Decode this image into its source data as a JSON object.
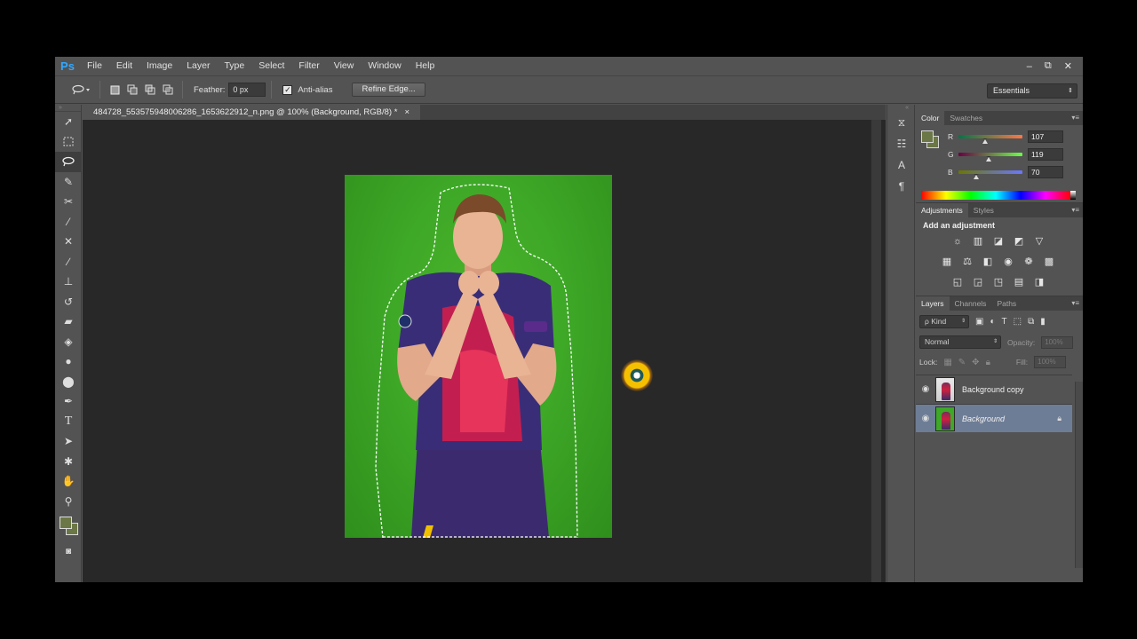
{
  "app": {
    "logo": "Ps"
  },
  "menu": [
    "File",
    "Edit",
    "Image",
    "Layer",
    "Type",
    "Select",
    "Filter",
    "View",
    "Window",
    "Help"
  ],
  "window_controls": {
    "minimize": "–",
    "restore": "⧉",
    "close": "✕"
  },
  "options_bar": {
    "feather_label": "Feather:",
    "feather_value": "0 px",
    "antialias_label": "Anti-alias",
    "antialias_checked": "✓",
    "refine_edge": "Refine Edge...",
    "workspace": "Essentials"
  },
  "document": {
    "tab_title": "484728_553575948006286_1653622912_n.png @ 100% (Background, RGB/8) *",
    "close": "×"
  },
  "colors": {
    "foreground": "#6b7746",
    "background": "#6b7746",
    "canvas_bg": "#282828",
    "selection_blue": "#6e7d96"
  },
  "color_panel": {
    "tabs": [
      "Color",
      "Swatches"
    ],
    "r_label": "R",
    "r_value": "107",
    "g_label": "G",
    "g_value": "119",
    "b_label": "B",
    "b_value": "70"
  },
  "adjustments_panel": {
    "tabs": [
      "Adjustments",
      "Styles"
    ],
    "title": "Add an adjustment"
  },
  "layers_panel": {
    "tabs": [
      "Layers",
      "Channels",
      "Paths"
    ],
    "kind_filter": "ρ Kind",
    "blend_mode": "Normal",
    "opacity_label": "Opacity:",
    "opacity_value": "100%",
    "lock_label": "Lock:",
    "fill_label": "Fill:",
    "fill_value": "100%",
    "layers": [
      {
        "name": "Background copy",
        "selected": false
      },
      {
        "name": "Background",
        "selected": true
      }
    ]
  },
  "icons": {
    "tools": [
      "move-icon",
      "marquee-icon",
      "lasso-icon",
      "quick-selection-icon",
      "crop-icon",
      "eyedropper-icon",
      "healing-brush-icon",
      "brush-icon",
      "clone-stamp-icon",
      "history-brush-icon",
      "eraser-icon",
      "paint-bucket-icon",
      "blur-icon",
      "dodge-icon",
      "pen-icon",
      "type-icon",
      "path-selection-icon",
      "shape-icon",
      "hand-icon",
      "zoom-icon"
    ]
  }
}
